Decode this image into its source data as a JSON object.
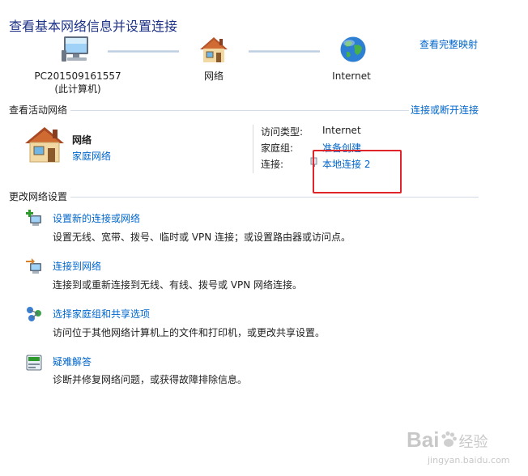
{
  "header": {
    "title": "查看基本网络信息并设置连接",
    "full_map_link": "查看完整映射"
  },
  "network_map": {
    "computer_name": "PC201509161557",
    "computer_sub": "(此计算机)",
    "network_label": "网络",
    "internet_label": "Internet"
  },
  "active_networks": {
    "section_title": "查看活动网络",
    "connect_link": "连接或断开连接",
    "network_name": "网络",
    "network_type": "家庭网络",
    "access_type_label": "访问类型:",
    "access_type_value": "Internet",
    "homegroup_label": "家庭组:",
    "homegroup_value": "准备创建",
    "connection_label": "连接:",
    "connection_value": "本地连接 2"
  },
  "change_settings": {
    "section_title": "更改网络设置",
    "tasks": [
      {
        "title": "设置新的连接或网络",
        "desc": "设置无线、宽带、拨号、临时或 VPN 连接；或设置路由器或访问点。",
        "icon": "new-connection-icon"
      },
      {
        "title": "连接到网络",
        "desc": "连接到或重新连接到无线、有线、拨号或 VPN 网络连接。",
        "icon": "connect-network-icon"
      },
      {
        "title": "选择家庭组和共享选项",
        "desc": "访问位于其他网络计算机上的文件和打印机，或更改共享设置。",
        "icon": "homegroup-icon"
      },
      {
        "title": "疑难解答",
        "desc": "诊断并修复网络问题，或获得故障排除信息。",
        "icon": "troubleshoot-icon"
      }
    ]
  },
  "watermark": {
    "brand": "Bai",
    "brand_tail": "经验",
    "url": "jingyan.baidu.com"
  },
  "colors": {
    "link": "#0066cc",
    "title": "#1e3287",
    "highlight_box": "#e0242b"
  }
}
